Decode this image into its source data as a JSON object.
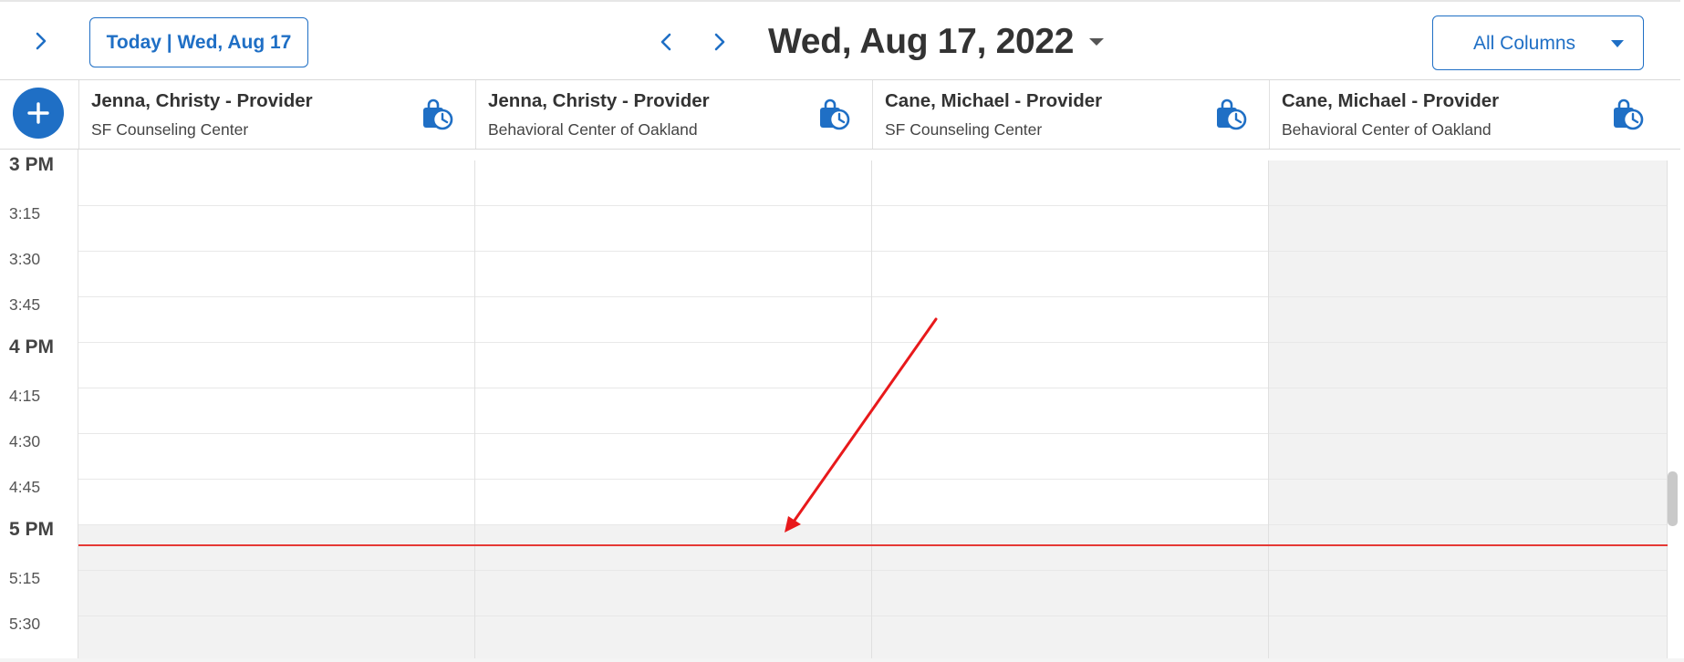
{
  "toolbar": {
    "today_label": "Today | Wed, Aug 17",
    "date_title": "Wed, Aug 17, 2022",
    "columns_label": "All Columns"
  },
  "providers": [
    {
      "name": "Jenna, Christy - Provider",
      "location": "SF Counseling Center"
    },
    {
      "name": "Jenna, Christy - Provider",
      "location": "Behavioral Center of Oakland"
    },
    {
      "name": "Cane, Michael - Provider",
      "location": "SF Counseling Center"
    },
    {
      "name": "Cane, Michael - Provider",
      "location": "Behavioral Center of Oakland"
    }
  ],
  "time_slots": [
    {
      "label": "3 PM",
      "type": "hour"
    },
    {
      "label": "3:15",
      "type": "quarter"
    },
    {
      "label": "3:30",
      "type": "quarter"
    },
    {
      "label": "3:45",
      "type": "quarter"
    },
    {
      "label": "4 PM",
      "type": "hour"
    },
    {
      "label": "4:15",
      "type": "quarter"
    },
    {
      "label": "4:30",
      "type": "quarter"
    },
    {
      "label": "4:45",
      "type": "quarter"
    },
    {
      "label": "5 PM",
      "type": "hour"
    },
    {
      "label": "5:15",
      "type": "quarter"
    },
    {
      "label": "5:30",
      "type": "quarter"
    }
  ],
  "availability_note": "Column 4 unavailable all slots; all columns unavailable from 5 PM",
  "colors": {
    "accent": "#1f6fc5",
    "current_time_line": "#e53935",
    "unavailable_slot": "#f2f2f2",
    "annotation_arrow": "#e8191b"
  }
}
